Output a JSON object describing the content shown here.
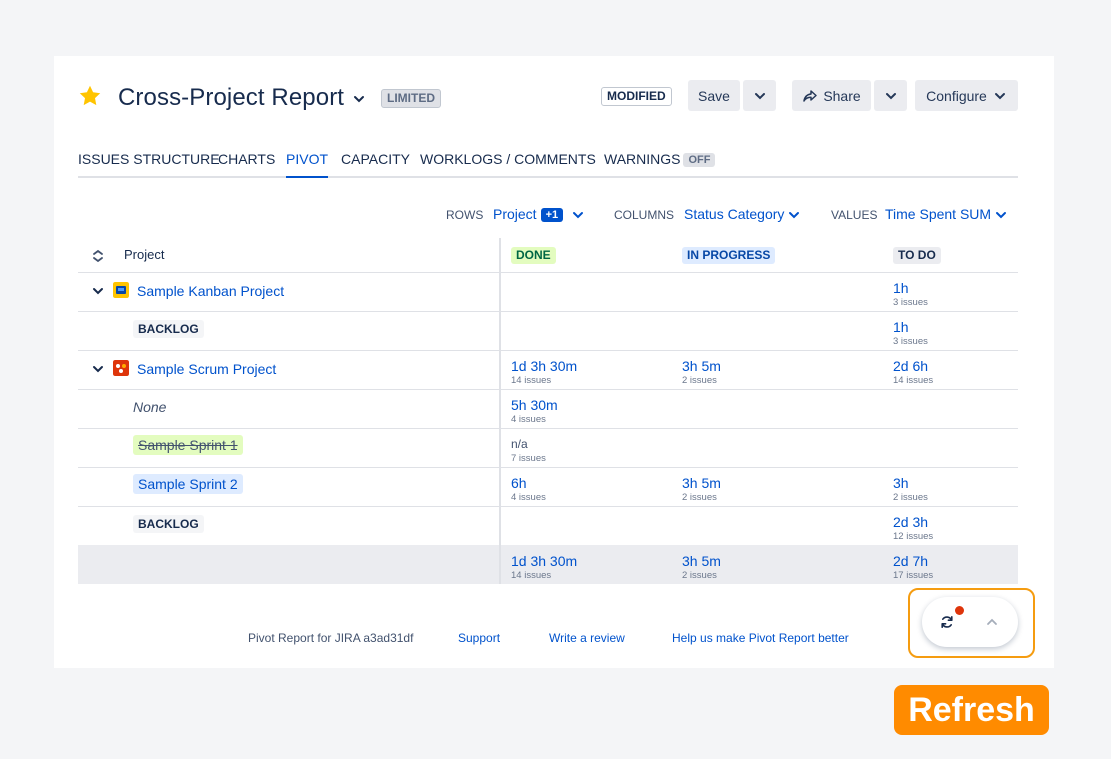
{
  "header": {
    "title": "Cross-Project Report",
    "limited_badge": "LIMITED",
    "modified_badge": "MODIFIED",
    "save_label": "Save",
    "share_label": "Share",
    "configure_label": "Configure"
  },
  "tabs": [
    {
      "label": "ISSUES STRUCTURE"
    },
    {
      "label": "CHARTS"
    },
    {
      "label": "PIVOT"
    },
    {
      "label": "CAPACITY"
    },
    {
      "label": "WORKLOGS / COMMENTS"
    },
    {
      "label": "WARNINGS"
    }
  ],
  "warnings_badge": "OFF",
  "controls": {
    "rows_label": "ROWS",
    "rows_value": "Project",
    "rows_badge": "+1",
    "columns_label": "COLUMNS",
    "columns_value": "Status Category",
    "values_label": "VALUES",
    "values_value": "Time Spent SUM"
  },
  "table": {
    "project_header": "Project",
    "columns": [
      "DONE",
      "IN PROGRESS",
      "TO DO"
    ],
    "rows": [
      {
        "label": "Sample Kanban Project",
        "todo": "1h",
        "todo_sub": "3 issues"
      },
      {
        "label": "BACKLOG",
        "todo": "1h",
        "todo_sub": "3 issues"
      },
      {
        "label": "Sample Scrum Project",
        "done": "1d 3h 30m",
        "done_sub": "14 issues",
        "prog": "3h 5m",
        "prog_sub": "2 issues",
        "todo": "2d 6h",
        "todo_sub": "14 issues"
      },
      {
        "label": "None",
        "done": "5h 30m",
        "done_sub": "4 issues"
      },
      {
        "label": "Sample Sprint 1",
        "done": "n/a",
        "done_sub": "7 issues"
      },
      {
        "label": "Sample Sprint 2",
        "done": "6h",
        "done_sub": "4 issues",
        "prog": "3h 5m",
        "prog_sub": "2 issues",
        "todo": "3h",
        "todo_sub": "2 issues"
      },
      {
        "label": "BACKLOG",
        "todo": "2d 3h",
        "todo_sub": "12 issues"
      }
    ],
    "total": {
      "done": "1d 3h 30m",
      "done_sub": "14 issues",
      "prog": "3h 5m",
      "prog_sub": "2 issues",
      "todo": "2d 7h",
      "todo_sub": "17 issues"
    }
  },
  "footer": {
    "version": "Pivot Report for JIRA a3ad31df",
    "support": "Support",
    "review": "Write a review",
    "help": "Help us make Pivot Report better"
  },
  "refresh_callout": "Refresh",
  "icons": {
    "favorite": "star-icon",
    "share": "share-icon",
    "dropdown": "chevron-down-icon",
    "sort": "sort-icon",
    "refresh": "refresh-icon",
    "collapse": "chevron-up-icon"
  },
  "colors": {
    "accent": "#0052cc",
    "star": "#ffc400",
    "callout": "#ff8b00",
    "notification": "#de350b"
  }
}
